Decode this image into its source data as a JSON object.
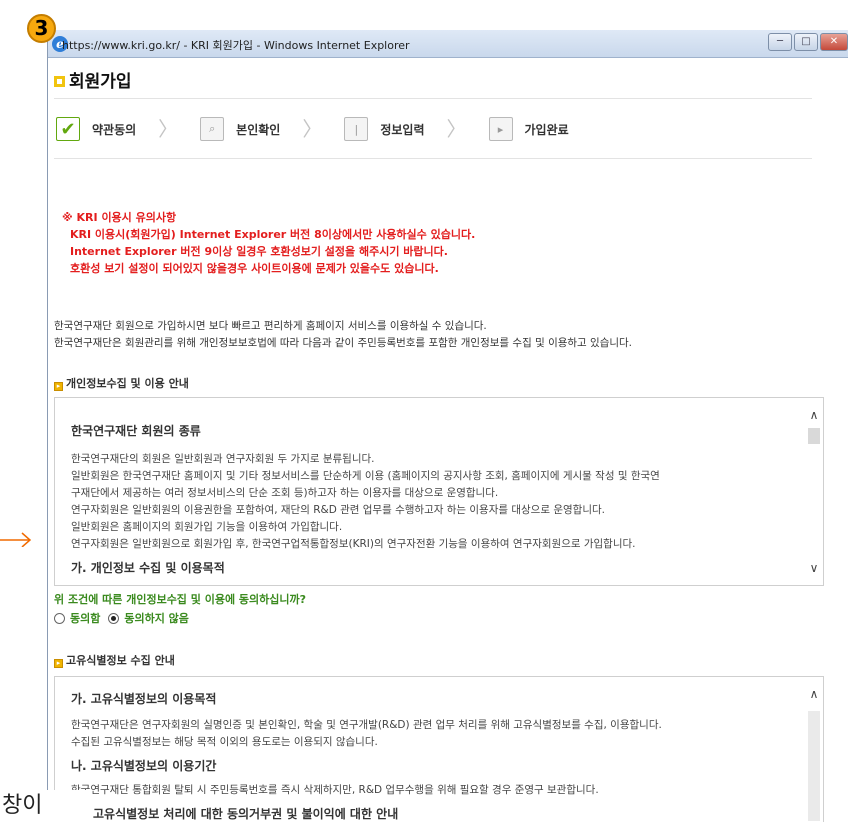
{
  "badge": "3",
  "window": {
    "title": "https://www.kri.go.kr/ - KRI 회원가입 - Windows Internet Explorer",
    "btn_min": "─",
    "btn_max": "□",
    "btn_close": "✕"
  },
  "page": {
    "title": "회원가입",
    "steps": [
      {
        "label": "약관동의",
        "icon": "check-icon",
        "glyph": "✔"
      },
      {
        "label": "본인확인",
        "icon": "search-icon",
        "glyph": "⌕"
      },
      {
        "label": "정보입력",
        "icon": "input-icon",
        "glyph": "|"
      },
      {
        "label": "가입완료",
        "icon": "play-icon",
        "glyph": "▸"
      }
    ],
    "step_separator": "〉"
  },
  "notice": {
    "title": "※ KRI 이용시 유의사항",
    "lines": [
      "KRI 이용시(회원가입) Internet Explorer 버전 8이상에서만 사용하실수 있습니다.",
      "Internet Explorer 버전 9이상 일경우 호환성보기 설정을 해주시기 바랍니다.",
      "호환성 보기 설정이 되어있지 않을경우 사이트이용에 문제가 있을수도 있습니다."
    ]
  },
  "intro": [
    "한국연구재단 회원으로 가입하시면 보다 빠르고 편리하게 홈페이지 서비스를 이용하실 수 있습니다.",
    "한국연구재단은 회원관리를 위해 개인정보보호법에 따라 다음과 같이 주민등록번호를 포함한 개인정보를 수집 및 이용하고 있습니다."
  ],
  "privacy_section": {
    "heading": "개인정보수집 및 이용 안내",
    "box_title": "한국연구재단 회원의 종류",
    "lines": [
      "한국연구재단의 회원은 일반회원과 연구자회원 두 가지로 분류됩니다.",
      "일반회원은 한국연구재단 홈페이지 및 기타 정보서비스를 단순하게 이용 (홈페이지의 공지사항 조회, 홈페이지에 게시물 작성 및 한국연",
      "구재단에서 제공하는 여러 정보서비스의 단순 조회 등)하고자 하는 이용자를 대상으로 운영합니다.",
      "연구자회원은 일반회원의 이용권한을 포함하여, 재단의 R&D 관련 업무를 수행하고자 하는 이용자를 대상으로 운영합니다.",
      "일반회원은 홈페이지의 회원가입 기능을 이용하여 가입합니다.",
      "연구자회원은 일반회원으로 회원가입 후, 한국연구업적통합정보(KRI)의 연구자전환 기능을 이용하여 연구자회원으로 가입합니다."
    ],
    "sub_title": "가. 개인정보 수집 및 이용목적",
    "question": "위 조건에 따른 개인정보수집 및 이용에 동의하십니까?",
    "options": [
      "동의함",
      "동의하지 않음"
    ],
    "selected_option": "동의하지 않음"
  },
  "unique_id_section": {
    "heading": "고유식별정보 수집 안내",
    "box_title": "가. 고유식별정보의 이용목적",
    "lines_a": [
      "한국연구재단은 연구자회원의 실명인증 및 본인확인, 학술 및 연구개발(R&D) 관련 업무 처리를 위해 고유식별정보를 수집, 이용합니다.",
      "수집된 고유식별정보는 해당 목적 이외의 용도로는 이용되지 않습니다."
    ],
    "sub_title_b": "나. 고유식별정보의 이용기간",
    "lines_b": [
      "한국연구재단 통합회원 탈퇴 시 주민등록번호를 즉시 삭제하지만, R&D 업무수행을 위해 필요할 경우 준영구 보관합니다."
    ],
    "sub_title_c": "고유식별정보 처리에 대한 동의거부권 및 불이익에 대한 안내"
  },
  "annotation": {
    "edge_text": "창이"
  },
  "colors": {
    "notice_red": "#e31e1e",
    "agree_green": "#3a8a1e",
    "step_green": "#62a80f",
    "badge_orange": "#f7a90e",
    "arrow_orange": "#f06a00"
  }
}
